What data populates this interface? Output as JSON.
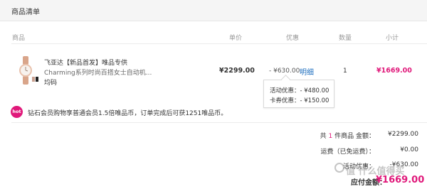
{
  "header": {
    "title": "商品清单"
  },
  "columns": {
    "product": "商品",
    "unit_price": "单价",
    "discount": "优惠",
    "quantity": "数量",
    "subtotal": "小计"
  },
  "item": {
    "name_line1": "飞亚达【新品首发】唯品专供",
    "name_line2": "Charming系列时尚百搭女士自动机...",
    "spec": "均码",
    "image_icon": "watch-product-thumbnail",
    "unit_price": "¥2299.00",
    "discount": "- ¥630.00",
    "detail_link": "明细",
    "quantity": "1",
    "subtotal": "¥1669.00"
  },
  "tooltip": {
    "row1": "活动优惠：- ¥480.00",
    "row2": "卡券优惠：- ¥150.00"
  },
  "promo": {
    "badge": "hot",
    "text": "钻石会员购物享普通会员1.5倍唯品币，订单完成后可获1251唯品币。"
  },
  "summary": {
    "count_prefix": "共",
    "count": "1",
    "count_suffix": "件商品 金额：",
    "amount": "¥2299.00",
    "shipping_label": "运费（已免运费）：",
    "shipping_value": "¥0.00",
    "activity_label": "活动优惠：",
    "activity_value": "-¥630.00",
    "total_label": "应付金额：",
    "total_value": "¥1669.00"
  },
  "watermark": "值 什么值得买",
  "colors": {
    "accent": "#e0187a",
    "link": "#1f6fbf"
  }
}
